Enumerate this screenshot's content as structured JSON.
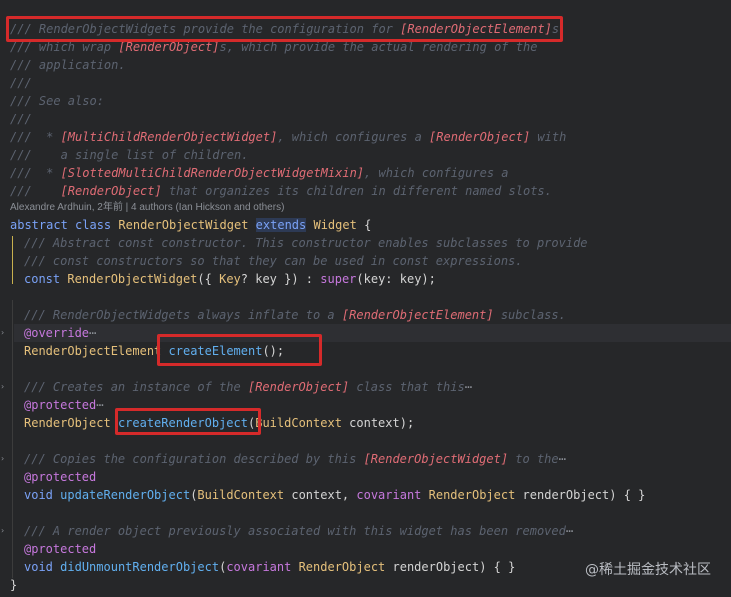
{
  "lines": {
    "l1": {
      "a": "/// RenderObjectWidgets provide the configuration for ",
      "b": "[RenderObjectElement]",
      "c": "s,"
    },
    "l2": {
      "a": "/// which wrap ",
      "b": "[RenderObject]",
      "c": "s, which provide the actual rendering of the"
    },
    "l3": "/// application.",
    "l4": "///",
    "l5": "/// See also:",
    "l6": "///",
    "l7": {
      "a": "///  * ",
      "b": "[MultiChildRenderObjectWidget]",
      "c": ", which configures a ",
      "d": "[RenderObject]",
      "e": " with"
    },
    "l8": "///    a single list of children.",
    "l9": {
      "a": "///  * ",
      "b": "[SlottedMultiChildRenderObjectWidgetMixin]",
      "c": ", which configures a"
    },
    "l10": {
      "a": "///    ",
      "b": "[RenderObject]",
      "c": " that organizes its children in different named slots."
    },
    "blame": "Alexandre Ardhuin, 2年前 | 4 authors (Ian Hickson and others)",
    "classdecl": {
      "kw1": "abstract",
      "kw2": "class",
      "name": "RenderObjectWidget",
      "kw3": "extends",
      "sup": "Widget",
      "brace": "{"
    },
    "c1": "/// Abstract const constructor. This constructor enables subclasses to provide",
    "c2": "/// const constructors so that they can be used in const expressions.",
    "ctor": {
      "kw": "const",
      "name": "RenderObjectWidget",
      "p1": "({ ",
      "type": "Key",
      "p2": "? key }) : ",
      "sup": "super",
      "p3": "(key: key);"
    },
    "c3": {
      "a": "/// RenderObjectWidgets always inflate to a ",
      "b": "[RenderObjectElement]",
      "c": " subclass."
    },
    "ov": "@override",
    "ce": {
      "type": "RenderObjectElement",
      "name": "createElement",
      "rest": "();"
    },
    "c4": {
      "a": "/// Creates an instance of the ",
      "b": "[RenderObject]",
      "c": " class that this"
    },
    "prot1": "@protected",
    "cro": {
      "type": "RenderObject",
      "name": "createRenderObject",
      "p1": "(",
      "ptype": "BuildContext",
      "rest": " context);"
    },
    "c5": {
      "a": "/// Copies the configuration described by this ",
      "b": "[RenderObjectWidget]",
      "c": " to the"
    },
    "prot2": "@protected",
    "uro": {
      "kw": "void",
      "name": "updateRenderObject",
      "p1": "(",
      "t1": "BuildContext",
      "p2": " context, ",
      "kw2": "covariant",
      "t2": " RenderObject",
      "rest": " renderObject) { }"
    },
    "c6": "/// A render object previously associated with this widget has been removed",
    "prot3": "@protected",
    "duro": {
      "kw": "void",
      "name": "didUnmountRenderObject",
      "p1": "(",
      "kw2": "covariant",
      "t2": " RenderObject",
      "rest": " renderObject) { }"
    },
    "close": "}"
  },
  "fold_marker": "⋯",
  "watermark": "@稀土掘金技术社区",
  "colors": {
    "highlight": "#d52a2a",
    "background": "#262729"
  }
}
